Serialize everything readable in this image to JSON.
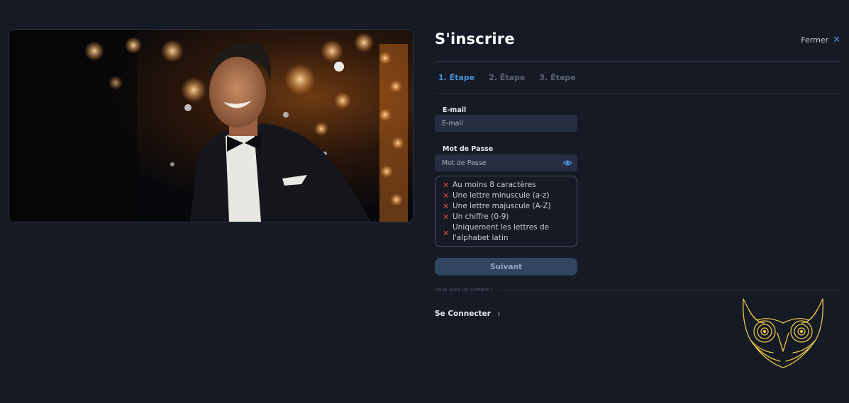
{
  "form": {
    "title": "S'inscrire",
    "close_label": "Fermer",
    "steps": [
      "1. Étape",
      "2. Étape",
      "3. Étape"
    ],
    "email": {
      "label": "E-mail",
      "placeholder": "E-mail"
    },
    "password": {
      "label": "Mot de Passe",
      "placeholder": "Mot de Passe"
    },
    "rules": [
      "Au moins 8 caractères",
      "Une lettre minuscule (a-z)",
      "Une lettre majuscule (A-Z)",
      "Un chiffre (0-9)",
      "Uniquement les lettres de l'alphabet latin"
    ],
    "submit_label": "Suivant",
    "have_account_text": "Vous avez un compte ?",
    "login_label": "Se Connecter"
  },
  "icons": {
    "close": "close-icon",
    "password_toggle": "eye-icon",
    "rule_status": "cross-icon",
    "login_arrow": "chevron-right-icon",
    "logo": "owl-logo"
  },
  "colors": {
    "background": "#161a24",
    "accent": "#4d8fd6",
    "error": "#e04848",
    "input_bg": "#262e42",
    "button_bg": "#2f4560",
    "logo_gold": "#e8c64a"
  }
}
